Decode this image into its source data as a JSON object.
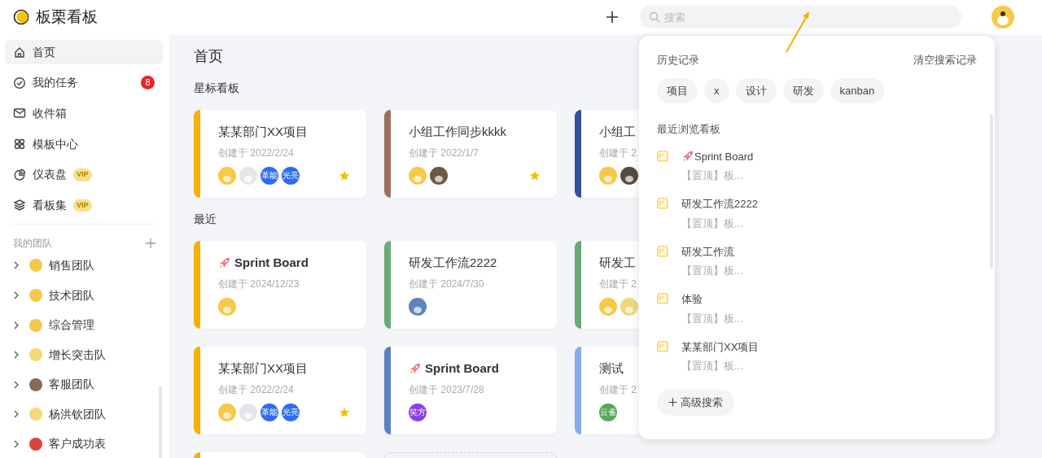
{
  "app": {
    "name": "板栗看板"
  },
  "header": {
    "search": {
      "placeholder": "搜索"
    }
  },
  "sidebar": {
    "items": [
      {
        "label": "首页",
        "selected": true
      },
      {
        "label": "我的任务",
        "selected": false,
        "badge": "8"
      },
      {
        "label": "收件箱",
        "selected": false
      },
      {
        "label": "模板中心",
        "selected": false
      },
      {
        "label": "仪表盘",
        "selected": false,
        "tag": "VIP"
      },
      {
        "label": "看板集",
        "selected": false,
        "tag": "VIP"
      }
    ],
    "teams_title": "我的团队",
    "teams": [
      {
        "name": "销售团队",
        "color": "#f2c94c"
      },
      {
        "name": "技术团队",
        "color": "#f2c94c"
      },
      {
        "name": "综合管理",
        "color": "#f2c94c"
      },
      {
        "name": "增长突击队",
        "color": "#f6d77a"
      },
      {
        "name": "客服团队",
        "color": "#8a6a52"
      },
      {
        "name": "杨洪钦团队",
        "color": "#f6d77a"
      },
      {
        "name": "客户成功表",
        "color": "#d9453b"
      }
    ]
  },
  "main": {
    "title": "首页",
    "sections": [
      {
        "title": "星标看板",
        "boards": [
          {
            "kind": "board",
            "color": "#f5b000",
            "title": "某某部门XX项目",
            "date": "创建于 2022/2/24",
            "starred": true,
            "avatars": [
              {
                "kind": "image",
                "color": "#f7c948"
              },
              {
                "kind": "image",
                "color": "#e4e6ea"
              },
              {
                "kind": "text",
                "text": "革能",
                "color": "#2f6bf0"
              },
              {
                "kind": "text",
                "text": "光亮",
                "color": "#2f6bf0"
              }
            ]
          },
          {
            "kind": "board",
            "color": "#9a6f60",
            "title": "小组工作同步kkkk",
            "date": "创建于 2022/1/7",
            "starred": true,
            "avatars": [
              {
                "kind": "image",
                "color": "#f7c948"
              },
              {
                "kind": "image",
                "color": "#6b5a44"
              }
            ]
          },
          {
            "kind": "board",
            "color": "#34509a",
            "title": "小组工",
            "date": "创建于 2",
            "starred": false,
            "avatars": [
              {
                "kind": "image",
                "color": "#f7c948"
              },
              {
                "kind": "image",
                "color": "#5a4a40"
              }
            ]
          }
        ]
      },
      {
        "title": "最近",
        "boards": [
          {
            "kind": "rocket-board",
            "color": "#f5b000",
            "title": "Sprint Board",
            "date": "创建于 2024/12/23",
            "starred": false,
            "avatars": [
              {
                "kind": "image",
                "color": "#f7c948"
              }
            ]
          },
          {
            "kind": "board",
            "color": "#6aab76",
            "title": "研发工作流2222",
            "date": "创建于 2024/7/30",
            "starred": false,
            "avatars": [
              {
                "kind": "image",
                "color": "#5d86b8"
              }
            ]
          },
          {
            "kind": "board",
            "color": "#6aab76",
            "title": "研发工",
            "date": "创建于 2",
            "starred": false,
            "avatars": [
              {
                "kind": "image",
                "color": "#f7c948"
              },
              {
                "kind": "image",
                "color": "#f0d878"
              }
            ]
          },
          {
            "kind": "board",
            "color": "#f5b000",
            "title": "某某部门XX项目",
            "date": "创建于 2022/2/24",
            "starred": true,
            "avatars": [
              {
                "kind": "image",
                "color": "#f7c948"
              },
              {
                "kind": "image",
                "color": "#e4e6ea"
              },
              {
                "kind": "text",
                "text": "革能",
                "color": "#2f6bf0"
              },
              {
                "kind": "text",
                "text": "光亮",
                "color": "#2f6bf0"
              }
            ]
          },
          {
            "kind": "rocket-board",
            "color": "#5b7fc4",
            "title": "Sprint Board",
            "date": "创建于 2023/7/28",
            "starred": false,
            "avatars": [
              {
                "kind": "text",
                "text": "笑方",
                "color": "#8b3fe6"
              }
            ]
          },
          {
            "kind": "board",
            "color": "#86aee6",
            "title": "测试",
            "date": "创建于 2",
            "starred": false,
            "avatars": [
              {
                "kind": "text",
                "text": "云雀",
                "color": "#57a85a"
              }
            ]
          },
          {
            "kind": "board",
            "color": "#f5b000"
          },
          {
            "kind": "empty"
          }
        ]
      }
    ]
  },
  "search_dropdown": {
    "history_title": "历史记录",
    "clear": "清空搜索记录",
    "history": [
      "项目",
      "x",
      "设计",
      "研发",
      "kanban"
    ],
    "recent_title": "最近浏览看板",
    "recent": [
      {
        "kind": "rocket",
        "title": "Sprint Board",
        "subtitle": "【置顶】板..."
      },
      {
        "kind": "plain",
        "title": "研发工作流2222",
        "subtitle": "【置顶】板..."
      },
      {
        "kind": "plain",
        "title": "研发工作流",
        "subtitle": "【置顶】板..."
      },
      {
        "kind": "plain",
        "title": "体验",
        "subtitle": "【置顶】板..."
      },
      {
        "kind": "plain",
        "title": "某某部门XX项目",
        "subtitle": "【置顶】板..."
      }
    ],
    "advanced": "高级搜索"
  }
}
